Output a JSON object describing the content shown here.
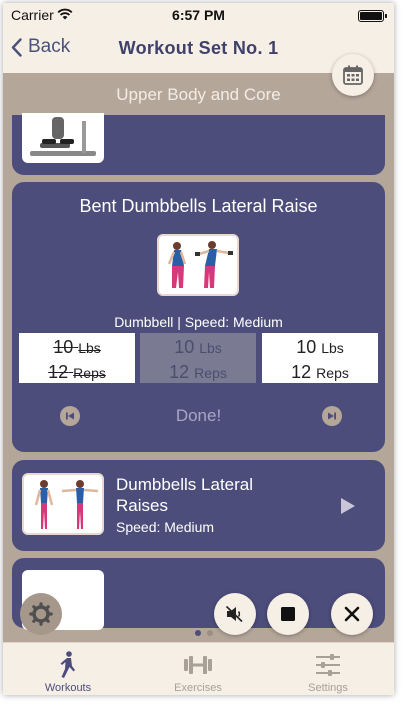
{
  "status_bar": {
    "carrier": "Carrier",
    "time": "6:57 PM"
  },
  "nav": {
    "back_label": "Back",
    "title": "Workout Set No. 1"
  },
  "section_title": "Upper Body and Core",
  "current_exercise": {
    "title": "Bent Dumbbells Lateral Raise",
    "meta": "Dumbbell | Speed: Medium",
    "sets": [
      {
        "weight": "10",
        "weight_unit": "Lbs",
        "reps": "12",
        "reps_unit": "Reps",
        "state": "completed"
      },
      {
        "weight": "10",
        "weight_unit": "Lbs",
        "reps": "12",
        "reps_unit": "Reps",
        "state": "current"
      },
      {
        "weight": "10",
        "weight_unit": "Lbs",
        "reps": "12",
        "reps_unit": "Reps",
        "state": "pending"
      }
    ],
    "done_label": "Done!"
  },
  "next_exercise": {
    "title": "Dumbbells Lateral Raises",
    "speed": "Speed: Medium"
  },
  "tabs": [
    {
      "label": "Workouts",
      "icon": "walking-person-icon",
      "active": true
    },
    {
      "label": "Exercises",
      "icon": "dumbbell-icon",
      "active": false
    },
    {
      "label": "Settings",
      "icon": "sliders-icon",
      "active": false
    }
  ],
  "page_indicator": {
    "pages": 2,
    "current": 1
  },
  "colors": {
    "accent": "#4c4d7b",
    "background": "#b5a69a",
    "bar": "#f6efe6",
    "card": "#4c4d7b"
  }
}
